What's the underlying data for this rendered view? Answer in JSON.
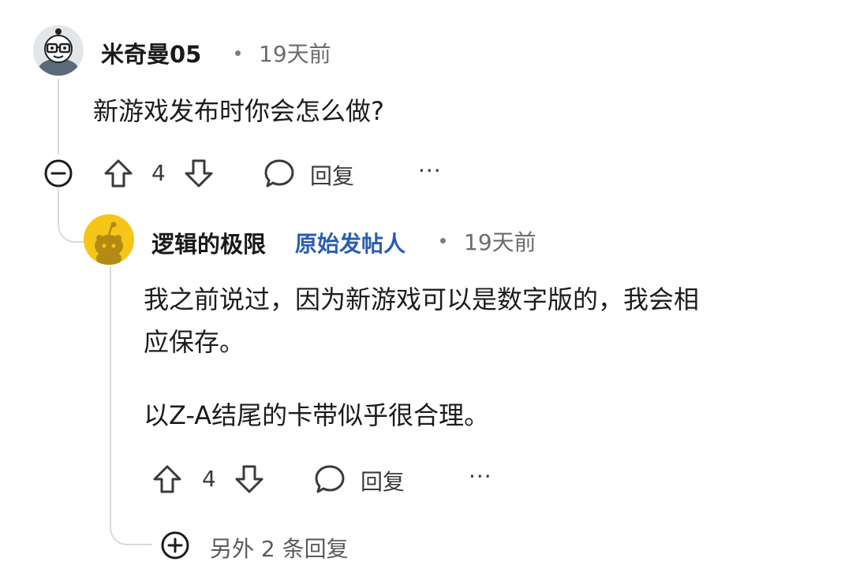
{
  "comment": {
    "username": "米奇曼05",
    "time": "19天前",
    "text": "新游戏发布时你会怎么做?",
    "votes": "4",
    "reply_label": "回复",
    "more_label": "···",
    "avatar_icon": "collapse-minus-icon"
  },
  "reply": {
    "username": "逻辑的极限",
    "op_badge": "原始发帖人",
    "time": "19天前",
    "paragraph_1_line_1": "我之前说过，因为新游戏可以是数字版的，我会相",
    "paragraph_1_line_2": "应保存。",
    "paragraph_2": "以Z-A结尾的卡带似乎很合理。",
    "votes": "4",
    "reply_label": "回复",
    "more_label": "···"
  },
  "more_replies": {
    "label": "另外 2 条回复"
  },
  "colors": {
    "thread_line": "#d8dadc",
    "op_badge": "#2a5db0",
    "avatar_yellow": "#f5c518"
  }
}
